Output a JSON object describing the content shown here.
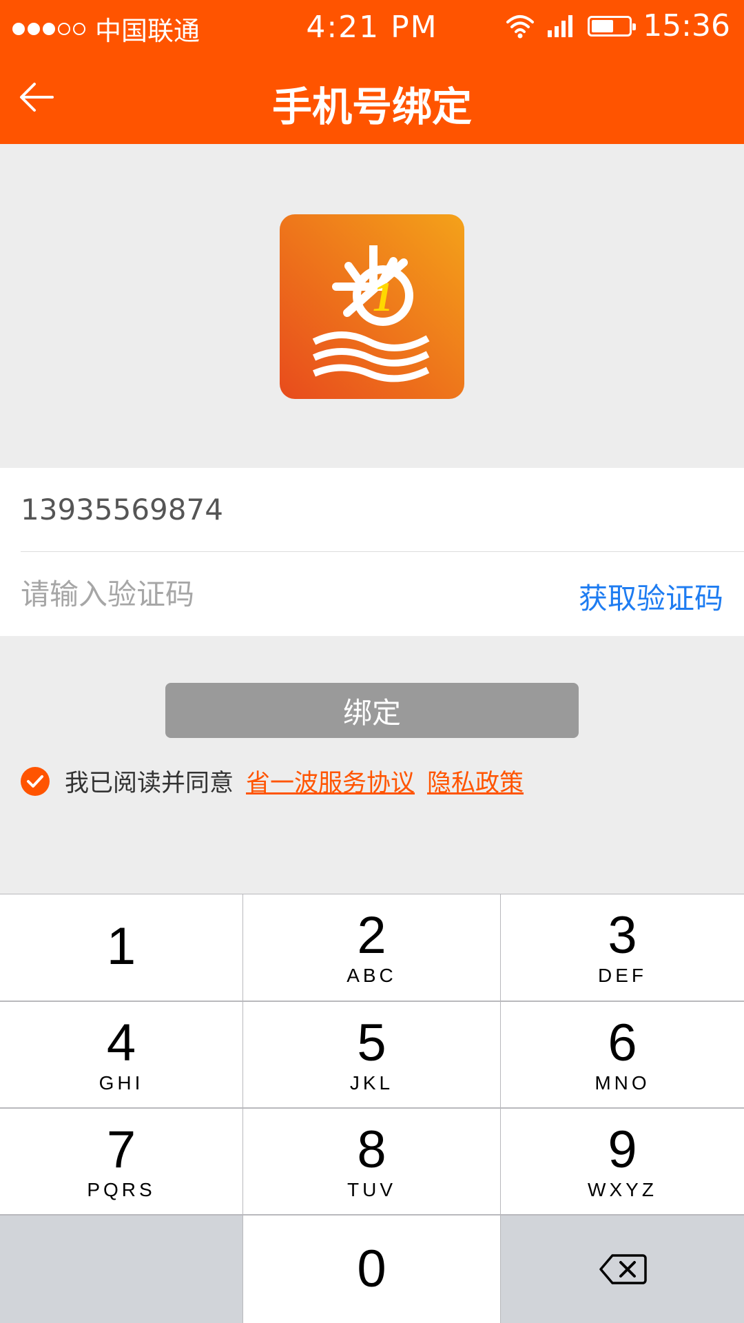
{
  "status_bar": {
    "carrier": "中国联通",
    "time": "4:21 PM",
    "clock": "15:36",
    "battery_level": 0.6
  },
  "nav": {
    "title": "手机号绑定",
    "back_icon": "arrow-left-icon"
  },
  "colors": {
    "brand": "#ff5400",
    "link_blue": "#1e7cf1",
    "button_disabled": "#9a9a9a"
  },
  "form": {
    "phone_value": "13935569874",
    "code_placeholder": "请输入验证码",
    "get_code_label": "获取验证码"
  },
  "bind_button_label": "绑定",
  "agreement": {
    "text": "我已阅读并同意",
    "service_link": "省一波服务协议",
    "privacy_link": "隐私政策"
  },
  "keypad": {
    "keys": [
      {
        "num": "1",
        "letters": ""
      },
      {
        "num": "2",
        "letters": "ABC"
      },
      {
        "num": "3",
        "letters": "DEF"
      },
      {
        "num": "4",
        "letters": "GHI"
      },
      {
        "num": "5",
        "letters": "JKL"
      },
      {
        "num": "6",
        "letters": "MNO"
      },
      {
        "num": "7",
        "letters": "PQRS"
      },
      {
        "num": "8",
        "letters": "TUV"
      },
      {
        "num": "9",
        "letters": "WXYZ"
      },
      {
        "num": "0",
        "letters": ""
      }
    ],
    "delete_icon": "backspace-icon"
  }
}
